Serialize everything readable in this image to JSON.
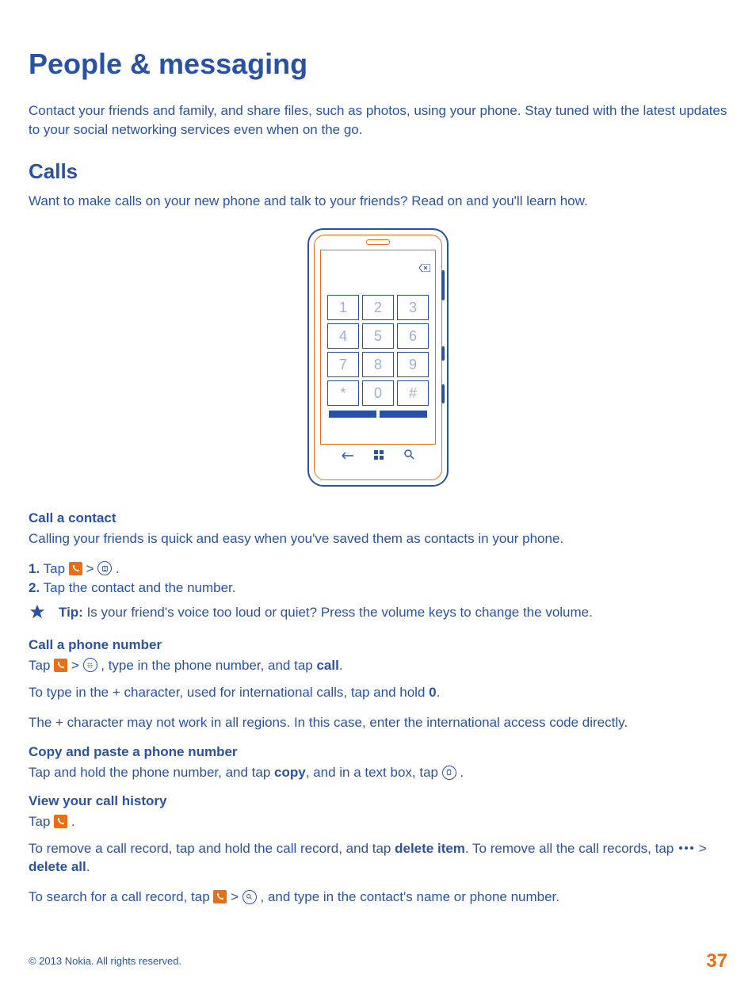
{
  "heading": "People & messaging",
  "intro": "Contact your friends and family, and share files, such as photos, using your phone. Stay tuned with the latest updates to your social networking services even when on the go.",
  "section_calls": {
    "title": "Calls",
    "intro": "Want to make calls on your new phone and talk to your friends? Read on and you'll learn how."
  },
  "call_contact": {
    "title": "Call a contact",
    "intro": "Calling your friends is quick and easy when you've saved them as contacts in your phone.",
    "step1_num": "1.",
    "step1_a": "Tap ",
    "step1_b": " > ",
    "step1_c": ".",
    "step2_num": "2.",
    "step2": "Tap the contact and the number.",
    "tip_label": "Tip:",
    "tip": " Is your friend's voice too loud or quiet? Press the volume keys to change the volume."
  },
  "call_number": {
    "title": "Call a phone number",
    "line1_a": "Tap ",
    "line1_b": " > ",
    "line1_c": ", type in the phone number, and tap ",
    "line1_bold": "call",
    "line1_d": ".",
    "line2_a": "To type in the + character, used for international calls, tap and hold ",
    "line2_bold": "0",
    "line2_b": ".",
    "line3": "The + character may not work in all regions. In this case, enter the international access code directly."
  },
  "copy_paste": {
    "title": "Copy and paste a phone number",
    "line_a": "Tap and hold the phone number, and tap ",
    "line_bold": "copy",
    "line_b": ", and in a text box, tap ",
    "line_c": "."
  },
  "history": {
    "title": "View your call history",
    "line1_a": "Tap ",
    "line1_b": ".",
    "line2_a": "To remove a call record, tap and hold the call record, and tap ",
    "line2_bold1": "delete item",
    "line2_b": ". To remove all the call records, tap ",
    "line2_gt": " > ",
    "line2_bold2": "delete all",
    "line2_c": ".",
    "line3_a": "To search for a call record, tap ",
    "line3_b": " > ",
    "line3_c": ", and type in the contact's name or phone number."
  },
  "footer": {
    "copyright": "© 2013 Nokia. All rights reserved.",
    "page": "37"
  },
  "keypad": [
    "1",
    "2",
    "3",
    "4",
    "5",
    "6",
    "7",
    "8",
    "9",
    "*",
    "0",
    "#"
  ]
}
